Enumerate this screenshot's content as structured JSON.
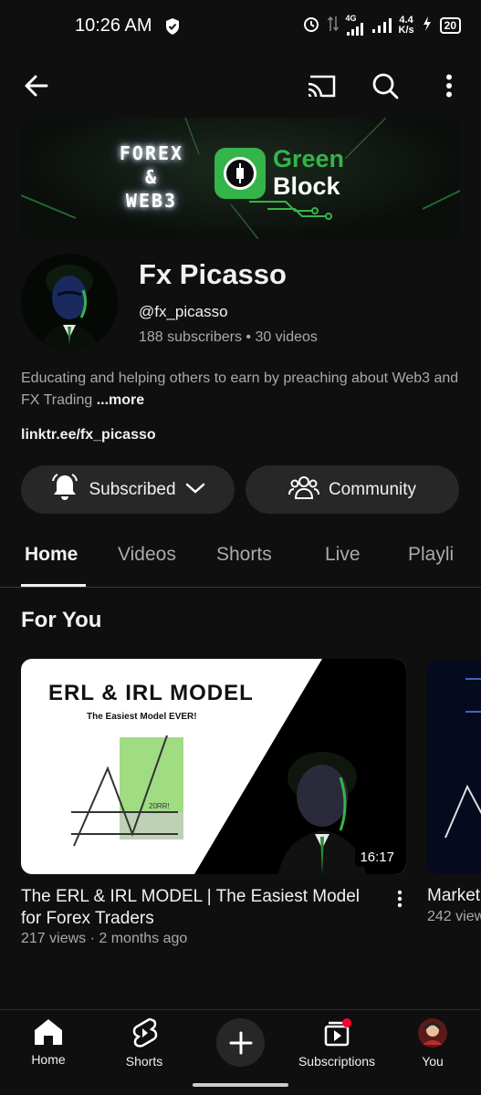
{
  "status_bar": {
    "time": "10:26 AM",
    "network_label": "4G",
    "speed_value": "4.4",
    "speed_unit": "K/s",
    "battery": "20"
  },
  "top_bar": {
    "icons": [
      "back-arrow-icon",
      "cast-icon",
      "search-icon",
      "more-vert-icon"
    ]
  },
  "banner": {
    "left_text_lines": [
      "FOREX",
      "&",
      "WEB3"
    ],
    "brand_line1": "Green",
    "brand_line2": "Block",
    "colors": {
      "brand_green": "#35b44a"
    }
  },
  "channel": {
    "name": "Fx Picasso",
    "handle": "@fx_picasso",
    "stats": "188 subscribers • 30 videos",
    "description": "Educating and helping others to earn by preaching about Web3 and FX Trading ",
    "more_label": "...more",
    "link": "linktr.ee/fx_picasso"
  },
  "actions": {
    "subscribed_label": "Subscribed",
    "community_label": "Community"
  },
  "tabs": [
    "Home",
    "Videos",
    "Shorts",
    "Live",
    "Playli"
  ],
  "section": {
    "title": "For You"
  },
  "videos": [
    {
      "thumb_title": "ERL & IRL MODEL",
      "thumb_subtitle": "The Easiest Model EVER!",
      "thumb_badge": "20RR!",
      "duration": "16:17",
      "title": "The ERL & IRL MODEL | The Easiest Model for Forex Traders",
      "meta": "217 views · 2 months ago"
    },
    {
      "title": "Market",
      "meta": "242 view"
    }
  ],
  "bottom_nav": {
    "home": "Home",
    "shorts": "Shorts",
    "subscriptions": "Subscriptions",
    "you": "You"
  }
}
